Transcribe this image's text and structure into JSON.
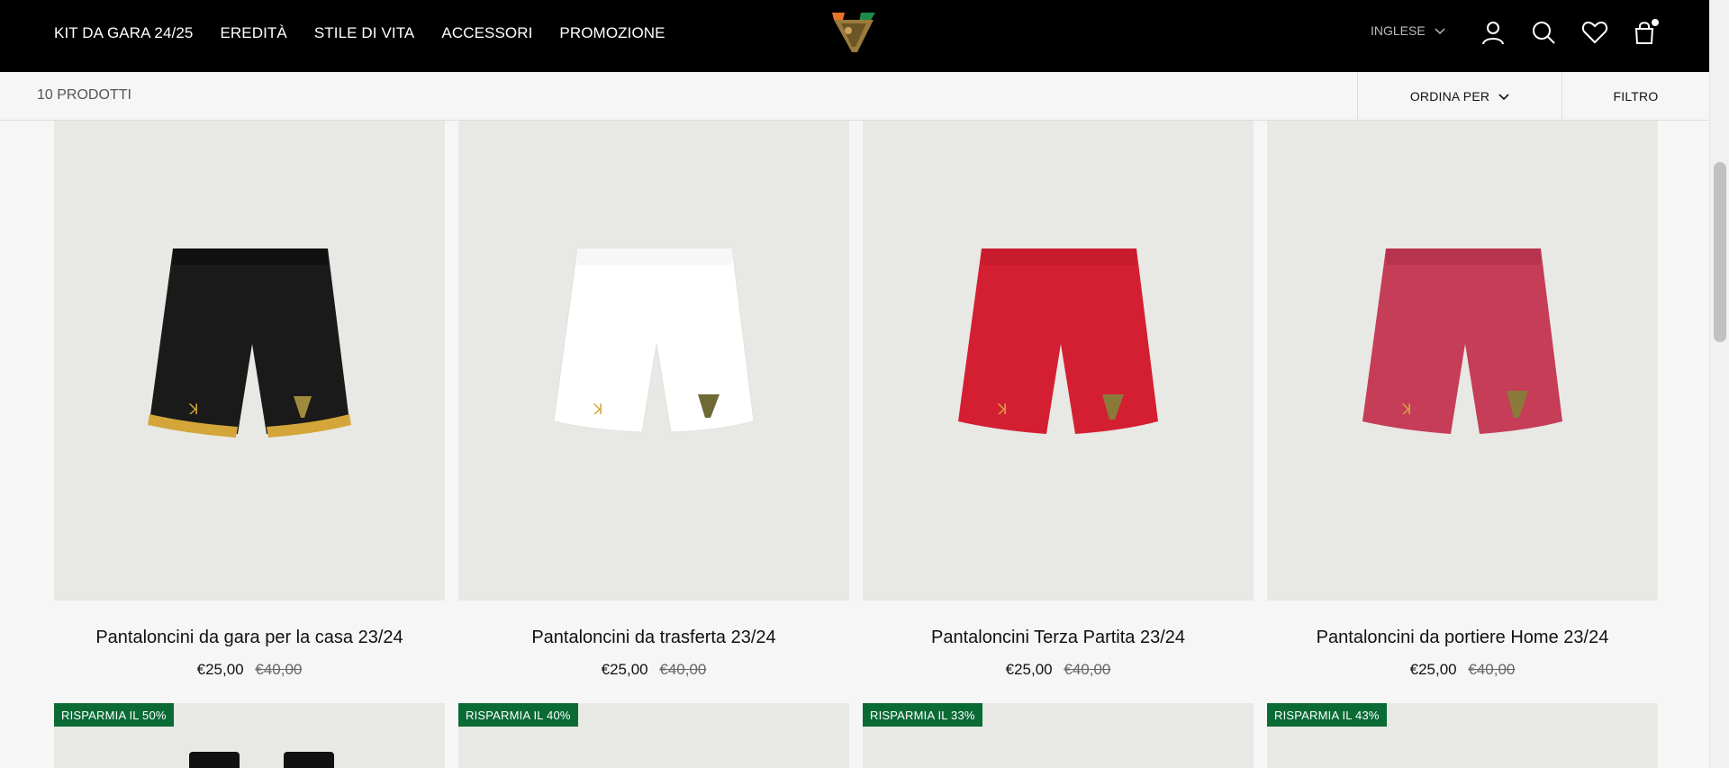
{
  "header": {
    "nav": [
      "KIT DA GARA 24/25",
      "EREDITÀ",
      "STILE DI VITA",
      "ACCESSORI",
      "PROMOZIONE"
    ],
    "language": "INGLESE",
    "icons": [
      "account-icon",
      "search-icon",
      "wishlist-icon",
      "cart-icon"
    ]
  },
  "toolbar": {
    "count": "10 PRODOTTI",
    "sort_label": "ORDINA PER",
    "filter_label": "FILTRO"
  },
  "products": [
    {
      "name": "Pantaloncini da gara per la casa 23/24",
      "price": "€25,00",
      "old_price": "€40,00",
      "color": "#1a1a1a",
      "trim": "#d4a63a"
    },
    {
      "name": "Pantaloncini da trasferta 23/24",
      "price": "€25,00",
      "old_price": "€40,00",
      "color": "#ffffff",
      "trim": "#ffffff"
    },
    {
      "name": "Pantaloncini Terza Partita 23/24",
      "price": "€25,00",
      "old_price": "€40,00",
      "color": "#d41f32",
      "trim": "#c81b2d"
    },
    {
      "name": "Pantaloncini da portiere Home 23/24",
      "price": "€25,00",
      "old_price": "€40,00",
      "color": "#c53d57",
      "trim": "#b8344e"
    }
  ],
  "next_row_badges": [
    "RISPARMIA IL 50%",
    "RISPARMIA IL 40%",
    "RISPARMIA IL 33%",
    "RISPARMIA IL 43%"
  ],
  "colors": {
    "accent_green": "#0a6b35",
    "header_bg": "#000000"
  }
}
